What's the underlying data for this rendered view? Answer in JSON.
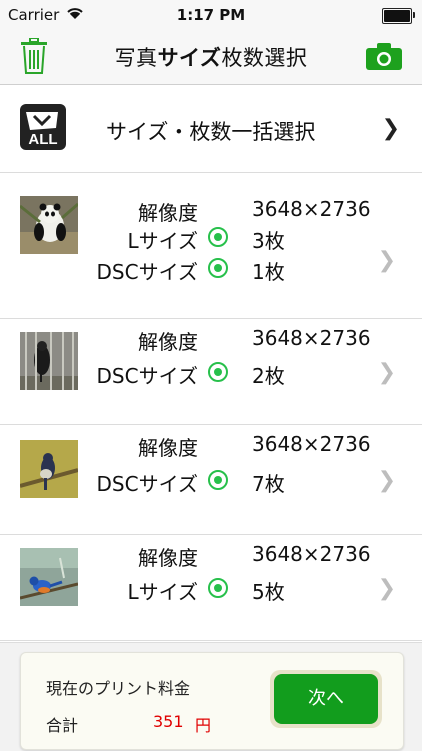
{
  "status": {
    "carrier": "Carrier",
    "time": "1:17 PM"
  },
  "nav": {
    "title_a": "写真",
    "title_b": "サイズ",
    "title_c": "枚数選択",
    "left_icon": "trash-icon",
    "right_icon": "camera-icon"
  },
  "all_select": {
    "label": "サイズ・枚数一括選択",
    "icon_text": "ALL"
  },
  "photos": [
    {
      "labels": [
        "解像度",
        "Lサイズ",
        "DSCサイズ"
      ],
      "values": [
        "3648×2736",
        "3枚",
        "1枚"
      ],
      "thumb": "panda-photo"
    },
    {
      "labels": [
        "解像度",
        "DSCサイズ"
      ],
      "values": [
        "3648×2736",
        "2枚"
      ],
      "thumb": "bird-cage-photo"
    },
    {
      "labels": [
        "解像度",
        "DSCサイズ"
      ],
      "values": [
        "3648×2736",
        "7枚"
      ],
      "thumb": "bird-branch-photo"
    },
    {
      "labels": [
        "解像度",
        "Lサイズ"
      ],
      "values": [
        "3648×2736",
        "5枚"
      ],
      "thumb": "bird-blue-photo"
    }
  ],
  "footer": {
    "price_title": "現在のプリント料金",
    "total_label": "合計",
    "total_amount": "351",
    "total_unit": "円",
    "next_button": "次へ"
  },
  "colors": {
    "accent_green": "#27c04b",
    "button_green": "#129d1d",
    "price_red": "#e00000"
  }
}
